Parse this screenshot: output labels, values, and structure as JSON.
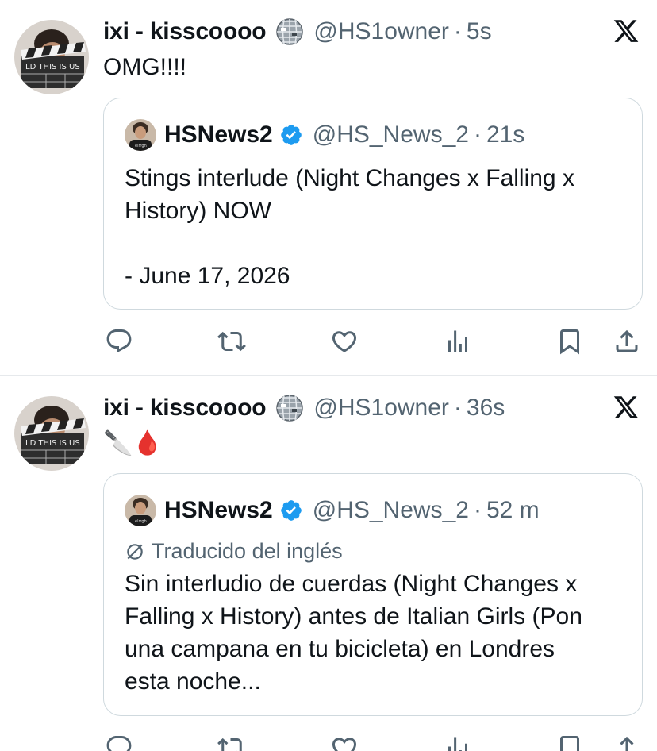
{
  "tweets": [
    {
      "author_name": "ixi - kisscoooo",
      "author_handle": "@HS1owner",
      "separator": "·",
      "time": "5s",
      "text": "OMG!!!!",
      "quote": {
        "author_name": "HSNews2",
        "author_handle": "@HS_News_2",
        "separator": "·",
        "time": "21s",
        "text": "Stings interlude (Night Changes x Falling x\nHistory) NOW\n\n- June 17, 2026"
      }
    },
    {
      "author_name": "ixi - kisscoooo",
      "author_handle": "@HS1owner",
      "separator": "·",
      "time": "36s",
      "text": "🔪🩸",
      "quote": {
        "author_name": "HSNews2",
        "author_handle": "@HS_News_2",
        "separator": "·",
        "time": "52 m",
        "translated_label": "Traducido del inglés",
        "text": "Sin interludio de cuerdas (Night Changes x\nFalling x History) antes de Italian Girls (Pon\nuna campana en tu bicicleta) en Londres\nesta noche..."
      }
    }
  ],
  "icons": {
    "reply": "speech-bubble-icon",
    "retweet": "retweet-icon",
    "like": "heart-icon",
    "views": "bar-chart-icon",
    "bookmark": "bookmark-icon",
    "share": "share-icon",
    "platform": "x-logo-icon",
    "verified": "verified-badge-icon",
    "name_emoji": "disco-ball-icon",
    "translate": "translate-icon"
  },
  "colors": {
    "text": "#0f1419",
    "secondary": "#536471",
    "verified": "#1d9bf0",
    "border": "#cfd9de",
    "icons": "#536471"
  }
}
